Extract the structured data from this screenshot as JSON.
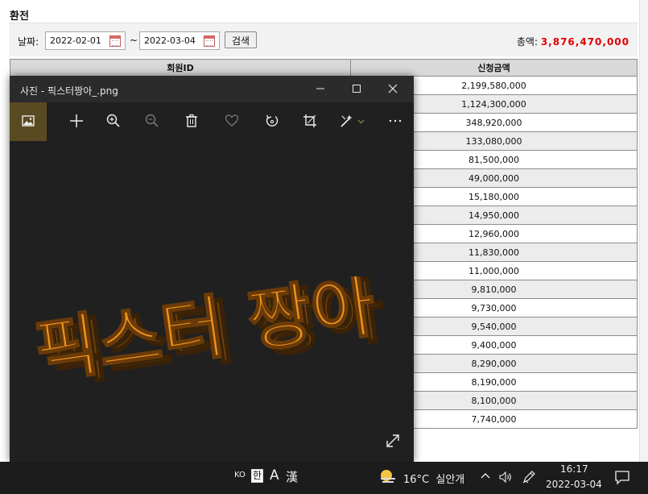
{
  "page": {
    "title": "환전",
    "date_label": "날짜:",
    "date_from": "2022-02-01",
    "date_to": "2022-03-04",
    "range_separator": "~",
    "search_button": "검색",
    "total_label": "총액:",
    "total_value": "3,876,470,000"
  },
  "table": {
    "columns": [
      "회원ID",
      "신청금액"
    ],
    "amounts": [
      "2,199,580,000",
      "1,124,300,000",
      "348,920,000",
      "133,080,000",
      "81,500,000",
      "49,000,000",
      "15,180,000",
      "14,950,000",
      "12,960,000",
      "11,830,000",
      "11,000,000",
      "9,810,000",
      "9,730,000",
      "9,540,000",
      "9,400,000",
      "8,290,000",
      "8,190,000",
      "8,100,000",
      "7,740,000"
    ]
  },
  "photo_window": {
    "title": "사진 - 픽스터짱아_.png",
    "image_text": "픽스터 짱아",
    "colors": {
      "accent": "#5a4a22",
      "art_fill": "#f0941c",
      "art_shadow": "#7a4a10"
    },
    "toolbar_icons": [
      "picture-icon",
      "plus-icon",
      "zoom-in-icon",
      "zoom-out-icon",
      "delete-icon",
      "heart-icon",
      "rotate-icon",
      "crop-icon",
      "edit-icon",
      "more-icon"
    ]
  },
  "taskbar": {
    "ime_lang": "KO",
    "ime_hangul": "한",
    "ime_alpha": "A",
    "ime_hanja": "漢",
    "temperature": "16°C",
    "weather": "실안개",
    "time": "16:17",
    "date": "2022-03-04"
  }
}
